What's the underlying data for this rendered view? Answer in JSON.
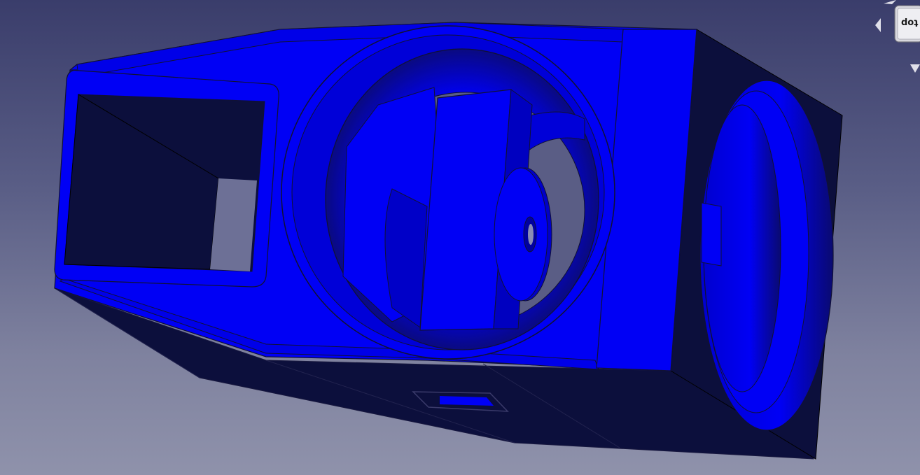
{
  "viewer": {
    "background_top": "#3a3d6b",
    "background_bottom": "#8f92ab",
    "model_color": "#0000f5",
    "model_shadow_color": "#0c0f3c"
  },
  "navigation_cube": {
    "face_label": "Top",
    "face_label_visible": "doʇ"
  }
}
